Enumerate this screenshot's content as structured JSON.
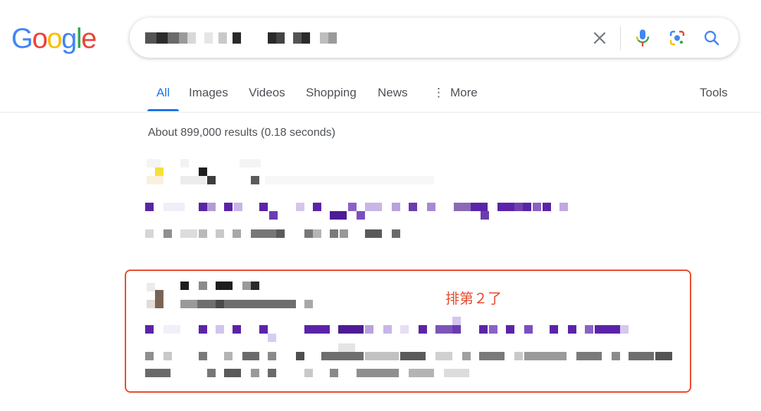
{
  "logo": {
    "text": "Google",
    "letters": [
      {
        "ch": "G",
        "color": "#4285f4"
      },
      {
        "ch": "o",
        "color": "#ea4335"
      },
      {
        "ch": "o",
        "color": "#fbbc05"
      },
      {
        "ch": "g",
        "color": "#4285f4"
      },
      {
        "ch": "l",
        "color": "#34a853"
      },
      {
        "ch": "e",
        "color": "#ea4335"
      }
    ]
  },
  "search": {
    "query_pixelated": true,
    "icons": {
      "clear": "close-icon",
      "voice": "microphone-icon",
      "lens": "camera-lens-icon",
      "submit": "search-icon"
    }
  },
  "tabs": [
    {
      "label": "All",
      "active": true
    },
    {
      "label": "Images"
    },
    {
      "label": "Videos"
    },
    {
      "label": "Shopping"
    },
    {
      "label": "News"
    },
    {
      "label": "More"
    }
  ],
  "tools_label": "Tools",
  "result_stats": "About 899,000 results (0.18 seconds)",
  "annotation": "排第２了",
  "colors": {
    "accent": "#1a73e8",
    "highlight": "#e8492b",
    "visited": "#681da8"
  }
}
